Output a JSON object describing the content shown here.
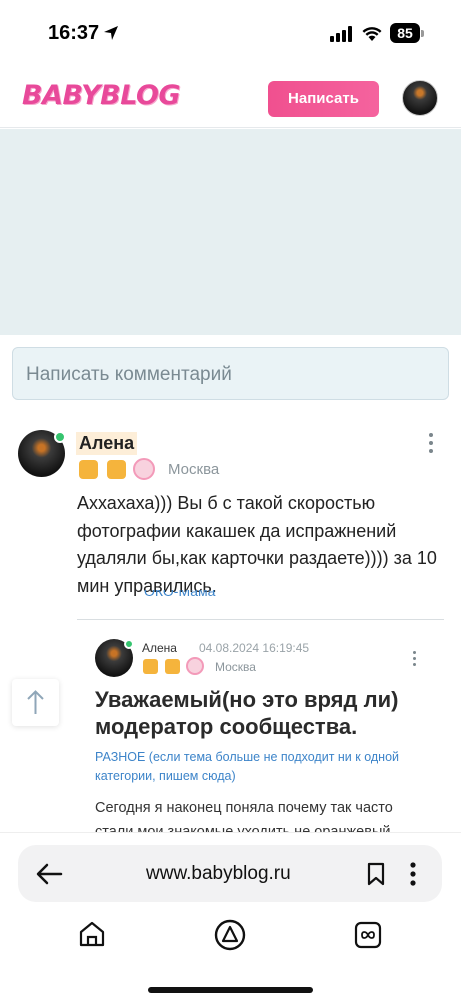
{
  "status_bar": {
    "time": "16:37",
    "battery": "85"
  },
  "header": {
    "logo": "BABYBLOG",
    "write_button": "Написать"
  },
  "comment_input": {
    "placeholder": "Написать комментарий"
  },
  "comment": {
    "author": "Алена",
    "city": "Москва",
    "text": "Аххахаха))) Вы б с такой скоростью фотографии какашек да испражнений удаляли бы,как карточки раздаете)))) за 10 мин управились.",
    "partially_hidden_text": "ОКО-Мама"
  },
  "quoted_post": {
    "author": "Алена",
    "date": "04.08.2024 16:19:45",
    "city": "Москва",
    "title": "Уважаемый(но это вряд ли) модератор сообщества.",
    "category": "РАЗНОЕ (если тема больше не подходит ни к одной категории, пишем сюда)",
    "body": "Сегодня я наконец поняла почему так часто стали мои знакомые уходить не оранжевый"
  },
  "browser": {
    "url": "www.babyblog.ru"
  }
}
